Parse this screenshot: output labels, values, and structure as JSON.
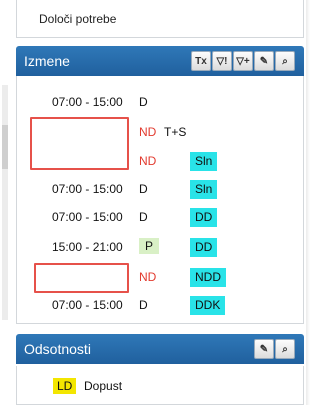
{
  "top_panel": {
    "link_label": "Določi potrebe"
  },
  "izmene": {
    "title": "Izmene",
    "tools": [
      {
        "name": "clear-tx-icon",
        "glyph": "Tx"
      },
      {
        "name": "filter-warning-icon",
        "glyph": "▽!"
      },
      {
        "name": "filter-add-icon",
        "glyph": "▽+"
      },
      {
        "name": "edit-icon",
        "glyph": "✎"
      },
      {
        "name": "search-icon",
        "glyph": "⌕"
      }
    ],
    "rows": [
      {
        "time": "07:00 - 15:00",
        "code": "D",
        "code_style": "plain",
        "extra": "",
        "badge": ""
      },
      {
        "time": "",
        "code": "ND",
        "code_style": "red",
        "extra": "T+S",
        "badge": ""
      },
      {
        "time": "",
        "code": "ND",
        "code_style": "red",
        "extra": "",
        "badge": "Sln"
      },
      {
        "time": "07:00 - 15:00",
        "code": "D",
        "code_style": "plain",
        "extra": "",
        "badge": "Sln"
      },
      {
        "time": "07:00 - 15:00",
        "code": "D",
        "code_style": "plain",
        "extra": "",
        "badge": "DD"
      },
      {
        "time": "15:00 - 21:00",
        "code": "P",
        "code_style": "green",
        "extra": "",
        "badge": "DD"
      },
      {
        "time": "",
        "code": "ND",
        "code_style": "red",
        "extra": "",
        "badge": "NDD"
      },
      {
        "time": "07:00 - 15:00",
        "code": "D",
        "code_style": "plain",
        "extra": "",
        "badge": "DDK"
      }
    ]
  },
  "odsotnosti": {
    "title": "Odsotnosti",
    "tools": [
      {
        "name": "edit-icon",
        "glyph": "✎"
      },
      {
        "name": "search-icon",
        "glyph": "⌕"
      }
    ],
    "first_item": {
      "badge": "LD",
      "label": "Dopust"
    }
  },
  "colors": {
    "header_blue": "#2870b0",
    "badge_cyan": "#29e3e8",
    "code_red": "#e23a2e",
    "highlight_red": "#e6514a",
    "p_green": "#d9f0c6",
    "ld_yellow": "#f3e600"
  }
}
